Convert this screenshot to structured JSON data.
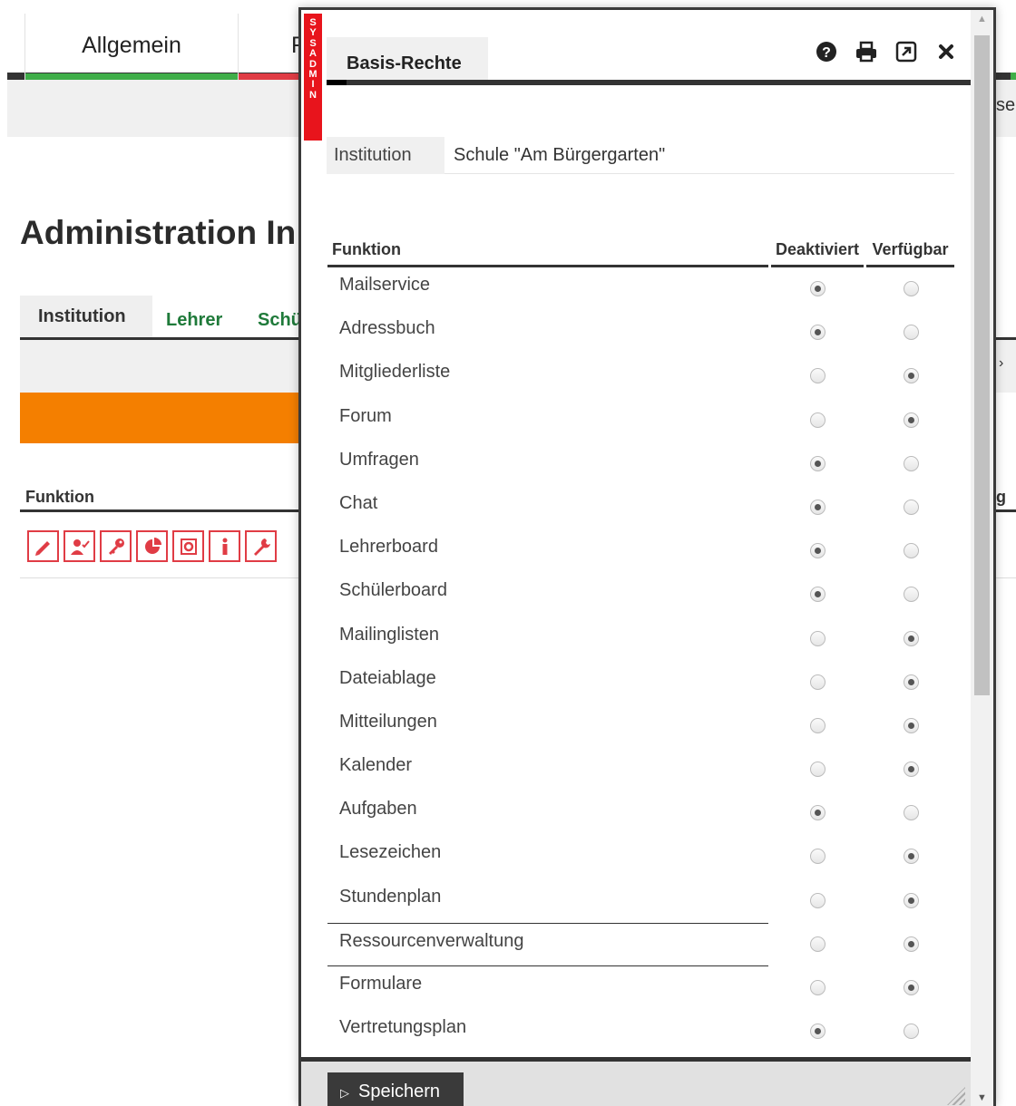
{
  "background": {
    "nav_tabs": [
      {
        "label": "Allgemein",
        "color": "#3fae49"
      },
      {
        "label": "F",
        "color": "#e03c45"
      }
    ],
    "right_fragment": "se",
    "heading": "Administration In",
    "subtabs": [
      "Institution",
      "Lehrer",
      "Schü"
    ],
    "funktion_label": "Funktion",
    "right_funktion_fragment": "g",
    "right_arrow": "›",
    "action_icons": [
      "pencil-icon",
      "user-check-icon",
      "key-icon",
      "pie-chart-icon",
      "target-icon",
      "info-icon",
      "wrench-icon"
    ],
    "accent_orange": "#f47f00"
  },
  "dialog": {
    "badge_letters": [
      "S",
      "Y",
      "S",
      "A",
      "D",
      "M",
      "I",
      "N"
    ],
    "tab_label": "Basis-Rechte",
    "header_icons": [
      "help-icon",
      "print-icon",
      "popout-icon",
      "close-icon"
    ],
    "institution": {
      "label": "Institution",
      "value": "Schule \"Am Bürgergarten\""
    },
    "table": {
      "headers": {
        "funktion": "Funktion",
        "deaktiviert": "Deaktiviert",
        "verfuegbar": "Verfügbar"
      },
      "rows": [
        {
          "label": "Mailservice",
          "value": "deaktiviert"
        },
        {
          "label": "Adressbuch",
          "value": "deaktiviert"
        },
        {
          "label": "Mitgliederliste",
          "value": "verfuegbar"
        },
        {
          "label": "Forum",
          "value": "verfuegbar"
        },
        {
          "label": "Umfragen",
          "value": "deaktiviert"
        },
        {
          "label": "Chat",
          "value": "deaktiviert"
        },
        {
          "label": "Lehrerboard",
          "value": "deaktiviert"
        },
        {
          "label": "Schülerboard",
          "value": "deaktiviert"
        },
        {
          "label": "Mailinglisten",
          "value": "verfuegbar"
        },
        {
          "label": "Dateiablage",
          "value": "verfuegbar"
        },
        {
          "label": "Mitteilungen",
          "value": "verfuegbar"
        },
        {
          "label": "Kalender",
          "value": "verfuegbar"
        },
        {
          "label": "Aufgaben",
          "value": "deaktiviert"
        },
        {
          "label": "Lesezeichen",
          "value": "verfuegbar"
        },
        {
          "label": "Stundenplan",
          "value": "verfuegbar"
        },
        {
          "label": "Ressourcenverwaltung",
          "value": "verfuegbar"
        },
        {
          "label": "Formulare",
          "value": "verfuegbar"
        },
        {
          "label": "Vertretungsplan",
          "value": "deaktiviert"
        }
      ]
    },
    "save_label": "Speichern"
  }
}
